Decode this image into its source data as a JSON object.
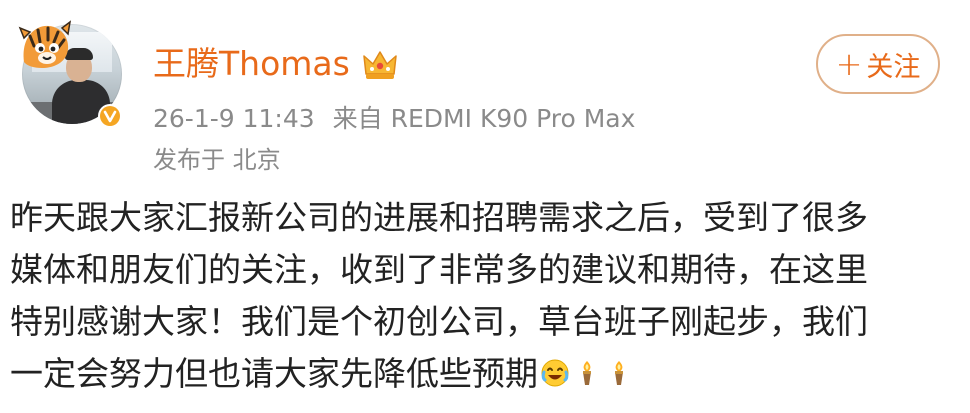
{
  "post": {
    "author": {
      "name": "王腾Thomas",
      "crown_icon": "crown-icon",
      "verified_icon": "verified-v-icon",
      "avatar_decoration": "tiger-icon"
    },
    "meta": {
      "date": "26-1-9 11:43",
      "source_prefix": "来自",
      "device": "REDMI K90 Pro Max",
      "location": "发布于 北京"
    },
    "follow_button": {
      "plus": "+",
      "label": "关注"
    },
    "body_lines": [
      "昨天跟大家汇报新公司的进展和招聘需求之后，受到了很多",
      "媒体和朋友们的关注，收到了非常多的建议和期待，在这里",
      "特别感谢大家！我们是个初创公司，草台班子刚起步，我们",
      "一定会努力但也请大家先降低些预期"
    ],
    "emojis": [
      "laugh-cry-emoji",
      "torch-emoji",
      "torch-emoji"
    ]
  },
  "colors": {
    "name_color": "#e86a1a",
    "meta_color": "#8a8a8a",
    "follow_border": "#e0b089",
    "text_color": "#222222"
  }
}
